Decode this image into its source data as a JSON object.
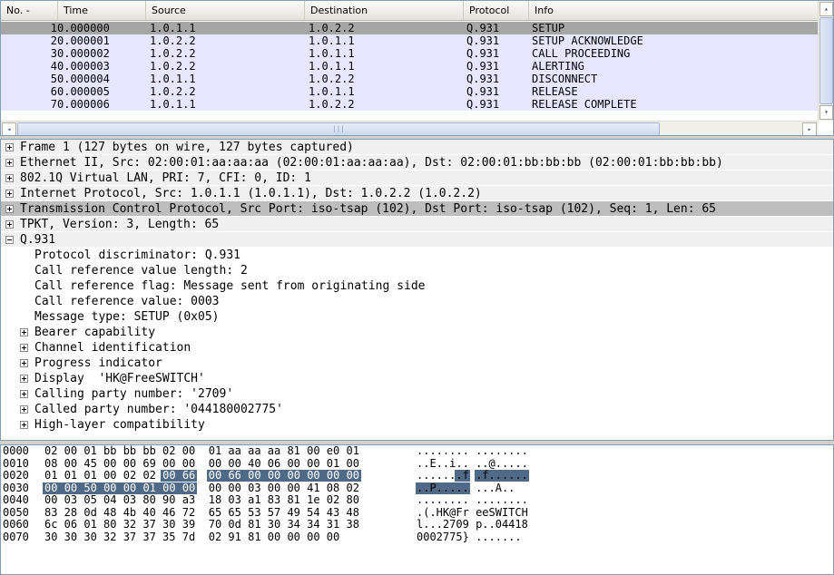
{
  "packet_list": {
    "columns": [
      "No. -",
      "Time",
      "Source",
      "Destination",
      "Protocol",
      "Info"
    ],
    "rows": [
      {
        "no": "1",
        "time": "0.000000",
        "source": "1.0.1.1",
        "destination": "1.0.2.2",
        "protocol": "Q.931",
        "info": "SETUP"
      },
      {
        "no": "2",
        "time": "0.000001",
        "source": "1.0.2.2",
        "destination": "1.0.1.1",
        "protocol": "Q.931",
        "info": "SETUP ACKNOWLEDGE"
      },
      {
        "no": "3",
        "time": "0.000002",
        "source": "1.0.2.2",
        "destination": "1.0.1.1",
        "protocol": "Q.931",
        "info": "CALL PROCEEDING"
      },
      {
        "no": "4",
        "time": "0.000003",
        "source": "1.0.2.2",
        "destination": "1.0.1.1",
        "protocol": "Q.931",
        "info": "ALERTING"
      },
      {
        "no": "5",
        "time": "0.000004",
        "source": "1.0.1.1",
        "destination": "1.0.2.2",
        "protocol": "Q.931",
        "info": "DISCONNECT"
      },
      {
        "no": "6",
        "time": "0.000005",
        "source": "1.0.2.2",
        "destination": "1.0.1.1",
        "protocol": "Q.931",
        "info": "RELEASE"
      },
      {
        "no": "7",
        "time": "0.000006",
        "source": "1.0.1.1",
        "destination": "1.0.2.2",
        "protocol": "Q.931",
        "info": "RELEASE COMPLETE"
      }
    ],
    "selected_row": 0,
    "scroll_left_glyph": "◂",
    "scroll_right_glyph": "▸",
    "scroll_up_glyph": "▴",
    "scroll_down_glyph": "▾",
    "scroll_grip_glyph": "|||"
  },
  "details": {
    "rows": [
      {
        "text": "Frame 1 (127 bytes on wire, 127 bytes captured)",
        "level": 0,
        "expander": "plus",
        "style": "top"
      },
      {
        "text": "Ethernet II, Src: 02:00:01:aa:aa:aa (02:00:01:aa:aa:aa), Dst: 02:00:01:bb:bb:bb (02:00:01:bb:bb:bb)",
        "level": 0,
        "expander": "plus",
        "style": "top"
      },
      {
        "text": "802.1Q Virtual LAN, PRI: 7, CFI: 0, ID: 1",
        "level": 0,
        "expander": "plus",
        "style": "top"
      },
      {
        "text": "Internet Protocol, Src: 1.0.1.1 (1.0.1.1), Dst: 1.0.2.2 (1.0.2.2)",
        "level": 0,
        "expander": "plus",
        "style": "top"
      },
      {
        "text": "Transmission Control Protocol, Src Port: iso-tsap (102), Dst Port: iso-tsap (102), Seq: 1, Len: 65",
        "level": 0,
        "expander": "plus",
        "style": "hl"
      },
      {
        "text": "TPKT, Version: 3, Length: 65",
        "level": 0,
        "expander": "plus",
        "style": "top"
      },
      {
        "text": "Q.931",
        "level": 0,
        "expander": "minus",
        "style": "top"
      },
      {
        "text": "Protocol discriminator: Q.931",
        "level": 1,
        "expander": "none",
        "style": "plain"
      },
      {
        "text": "Call reference value length: 2",
        "level": 1,
        "expander": "none",
        "style": "plain"
      },
      {
        "text": "Call reference flag: Message sent from originating side",
        "level": 1,
        "expander": "none",
        "style": "plain"
      },
      {
        "text": "Call reference value: 0003",
        "level": 1,
        "expander": "none",
        "style": "plain"
      },
      {
        "text": "Message type: SETUP (0x05)",
        "level": 1,
        "expander": "none",
        "style": "plain"
      },
      {
        "text": "Bearer capability",
        "level": 1,
        "expander": "plus",
        "style": "plain"
      },
      {
        "text": "Channel identification",
        "level": 1,
        "expander": "plus",
        "style": "plain"
      },
      {
        "text": "Progress indicator",
        "level": 1,
        "expander": "plus",
        "style": "plain"
      },
      {
        "text": "Display  'HK@FreeSWITCH'",
        "level": 1,
        "expander": "plus",
        "style": "plain"
      },
      {
        "text": "Calling party number: '2709'",
        "level": 1,
        "expander": "plus",
        "style": "plain"
      },
      {
        "text": "Called party number: '044180002775'",
        "level": 1,
        "expander": "plus",
        "style": "plain"
      },
      {
        "text": "High-layer compatibility",
        "level": 1,
        "expander": "plus",
        "style": "plain"
      }
    ]
  },
  "hex": {
    "rows": [
      {
        "offset": "0000",
        "left": "02 00 01 bb bb bb 02 00",
        "right": "01 aa aa aa 81 00 e0 01",
        "ascii_left": "........",
        "ascii_right": "........"
      },
      {
        "offset": "0010",
        "left": "08 00 45 00 00 69 00 00",
        "right": "00 00 40 06 00 00 01 00",
        "ascii_left": "..E..i..",
        "ascii_right": "..@....."
      },
      {
        "offset": "0020",
        "left": "01 01 01 00 02 02 00 66",
        "right": "00 66 00 00 00 00 00 00",
        "ascii_left": ".......f",
        "ascii_right": ".f......"
      },
      {
        "offset": "0030",
        "left": "00 00 50 00 00 01 00 00",
        "right": "00 00 03 00 00 41 08 02",
        "ascii_left": "..P.....",
        "ascii_right": "...A.."
      },
      {
        "offset": "0040",
        "left": "00 03 05 04 03 80 90 a3",
        "right": "18 03 a1 83 81 1e 02 80",
        "ascii_left": "........",
        "ascii_right": "........"
      },
      {
        "offset": "0050",
        "left": "83 28 0d 48 4b 40 46 72",
        "right": "65 65 53 57 49 54 43 48",
        "ascii_left": ".(.HK@Fr",
        "ascii_right": "eeSWITCH"
      },
      {
        "offset": "0060",
        "left": "6c 06 01 80 32 37 30 39",
        "right": "70 0d 81 30 34 34 31 38",
        "ascii_left": "l...2709",
        "ascii_right": "p..04418"
      },
      {
        "offset": "0070",
        "left": "30 30 30 32 37 37 35 7d",
        "right": "02 91 81 00 00 00 00",
        "ascii_left": "0002775}",
        "ascii_right": "......."
      }
    ],
    "highlight_color": "#4f6a86"
  }
}
